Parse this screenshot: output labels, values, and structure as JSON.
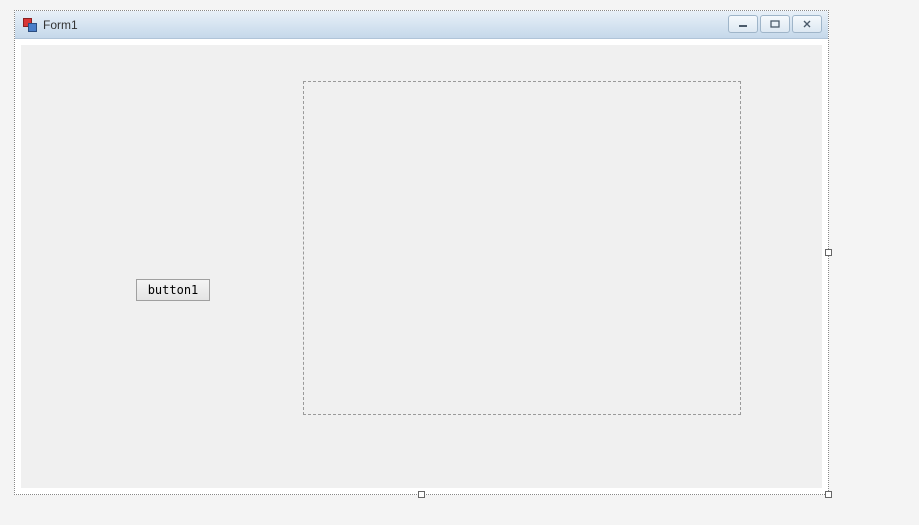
{
  "window": {
    "title": "Form1"
  },
  "controls": {
    "button1_label": "button1"
  }
}
